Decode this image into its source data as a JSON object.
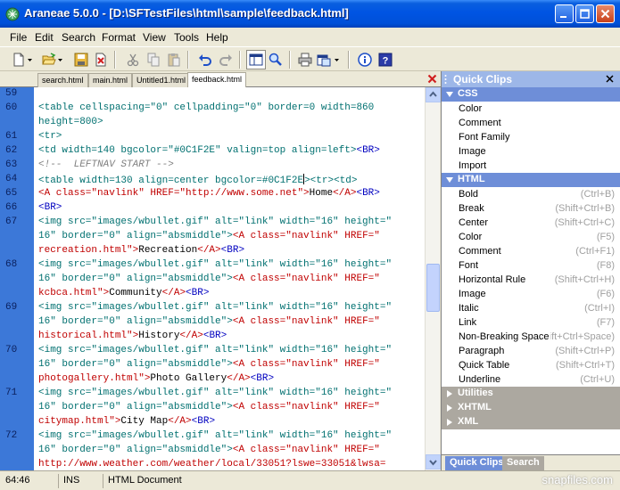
{
  "window": {
    "title": "Araneae 5.0.0 - [D:\\SFTestFiles\\html\\sample\\feedback.html]"
  },
  "menu": [
    "File",
    "Edit",
    "Search",
    "Format",
    "View",
    "Tools",
    "Help"
  ],
  "toolbar": {
    "icons": [
      "new-file-icon",
      "open-folder-icon",
      "save-icon",
      "close-file-icon",
      "cut-icon",
      "copy-icon",
      "paste-icon",
      "undo-icon",
      "redo-icon",
      "preview-icon",
      "find-icon",
      "print-icon",
      "browser-icon",
      "info-icon",
      "help-icon"
    ]
  },
  "tabs": [
    {
      "label": "search.html",
      "active": false
    },
    {
      "label": "main.html",
      "active": false
    },
    {
      "label": "Untitled1.html",
      "active": false
    },
    {
      "label": "feedback.html",
      "active": true
    }
  ],
  "line_numbers": [
    "59",
    "60",
    "61",
    "62",
    "63",
    "64",
    "65",
    "66",
    "67",
    "68",
    "69",
    "70",
    "71",
    "72"
  ],
  "code_text": {
    "l60a": "<table cellspacing=\"0\" cellpadding=\"0\" border=0 width=860",
    "l60b": "height=800>",
    "l61": "<tr>",
    "l62a": "<td width=140 bgcolor=\"#0C1F2E\" valign=top align=left>",
    "l62b": "<BR>",
    "l63": "<!--  LEFTNAV START -->",
    "l64a": "<table width=130 align=center bgcolor=#0C1F2E",
    "l64b": "><tr><td>",
    "l65a": "<A class=\"navlink\" HREF=\"http://www.some.net\">",
    "l65b": "Home",
    "l65c": "</A>",
    "l65d": "<BR>",
    "l66": "<BR>",
    "img_a": "<img src=\"images/wbullet.gif\" alt=\"link\" width=\"16\" height=\"",
    "img_b": "16\" border=\"0\" align=\"absmiddle\">",
    "img_c": "<A class=\"navlink\" HREF=\"",
    "l67c": "recreation.html\">",
    "l67t": "Recreation",
    "l68c": "kcbca.html\">",
    "l68t": "Community",
    "l69c": "historical.html\">",
    "l69t": "History",
    "l70c": "photogallery.html\">",
    "l70t": "Photo Gallery",
    "l71c": "citymap.html\">",
    "l71t": "City Map",
    "l72c": "http://www.weather.com/weather/local/33051?lswe=33051&lwsa=",
    "close_a": "</A>",
    "br": "<BR>"
  },
  "quick_clips": {
    "title": "Quick Clips",
    "css": {
      "label": "CSS",
      "items": [
        "Color",
        "Comment",
        "Font Family",
        "Image",
        "Import"
      ]
    },
    "html": {
      "label": "HTML",
      "items": [
        {
          "name": "Bold",
          "key": "(Ctrl+B)"
        },
        {
          "name": "Break",
          "key": "(Shift+Ctrl+B)"
        },
        {
          "name": "Center",
          "key": "(Shift+Ctrl+C)"
        },
        {
          "name": "Color",
          "key": "(F5)"
        },
        {
          "name": "Comment",
          "key": "(Ctrl+F1)"
        },
        {
          "name": "Font",
          "key": "(F8)"
        },
        {
          "name": "Horizontal Rule",
          "key": "(Shift+Ctrl+H)"
        },
        {
          "name": "Image",
          "key": "(F6)"
        },
        {
          "name": "Italic",
          "key": "(Ctrl+I)"
        },
        {
          "name": "Link",
          "key": "(F7)"
        },
        {
          "name": "Non-Breaking Space",
          "key": "ift+Ctrl+Space)"
        },
        {
          "name": "Paragraph",
          "key": "(Shift+Ctrl+P)"
        },
        {
          "name": "Quick Table",
          "key": "(Shift+Ctrl+T)"
        },
        {
          "name": "Underline",
          "key": "(Ctrl+U)"
        }
      ]
    },
    "collapsed": [
      "Utilities",
      "XHTML",
      "XML"
    ],
    "bottom_tabs": [
      "Quick Clips",
      "Search"
    ]
  },
  "status": {
    "position": "64:46",
    "mode": "INS",
    "doctype": "HTML Document",
    "watermark": "snapfiles.com"
  },
  "colors": {
    "titlebar": "#0054E3",
    "gutter": "#3C78D8",
    "tag": "#C00000",
    "string": "#007070",
    "markup": "#0000C0",
    "panel_header": "#9DB7E8"
  }
}
